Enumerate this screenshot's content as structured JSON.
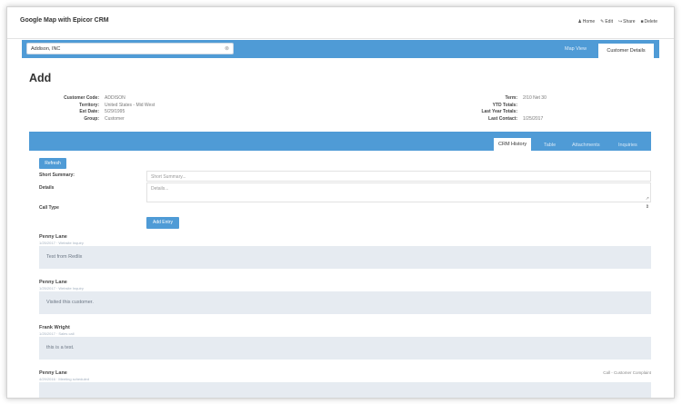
{
  "app": {
    "title": "Google Map with Epicor CRM"
  },
  "top_actions": [
    {
      "icon": "person-icon",
      "glyph": "♟",
      "label": "Home"
    },
    {
      "icon": "pencil-icon",
      "glyph": "✎",
      "label": "Edit"
    },
    {
      "icon": "share-icon",
      "glyph": "↪",
      "label": "Share"
    },
    {
      "icon": "trash-icon",
      "glyph": "■",
      "label": "Delete"
    }
  ],
  "search": {
    "value": "Addison, INC",
    "clear_icon": "⊗"
  },
  "view_tabs": {
    "map": "Map View",
    "customer": "Customer Details"
  },
  "page": {
    "heading": "Add"
  },
  "customer": {
    "left": [
      {
        "label": "Customer Code:",
        "value": "ADDISON"
      },
      {
        "label": "Territory:",
        "value": "United States - Mid West"
      },
      {
        "label": "Est Date:",
        "value": "5/29/1995"
      },
      {
        "label": "Group:",
        "value": "Customer"
      }
    ],
    "right": [
      {
        "label": "Term:",
        "value": "2/10 Net 30"
      },
      {
        "label": "YTD Totals:",
        "value": ""
      },
      {
        "label": "Last Year Totals:",
        "value": ""
      },
      {
        "label": "Last Contact:",
        "value": "1/25/2017"
      }
    ]
  },
  "crm_tabs": [
    "CRM History",
    "Table",
    "Attachments",
    "Inquiries"
  ],
  "form": {
    "refresh_label": "Refresh",
    "short_summary_label": "Short Summary:",
    "short_summary_placeholder": "Short Summary...",
    "details_label": "Details",
    "details_placeholder": "Details...",
    "call_type_label": "Call Type",
    "add_entry_label": "Add Entry",
    "select_arrows": "⇕",
    "resize_glyph": "↗"
  },
  "entries": [
    {
      "author": "Penny Lane",
      "meta": "1/25/2017 · Website Inquiry",
      "text": "Test from Redlix",
      "right": ""
    },
    {
      "author": "Penny Lane",
      "meta": "1/25/2017 · Website Inquiry",
      "text": "Visited this customer.",
      "right": ""
    },
    {
      "author": "Frank Wright",
      "meta": "1/25/2017 · Sales call",
      "text": "this is a test.",
      "right": ""
    },
    {
      "author": "Penny Lane",
      "meta": "4/29/2016 · Meeting scheduled",
      "text": "",
      "right": "Call - Customer Complaint"
    }
  ]
}
